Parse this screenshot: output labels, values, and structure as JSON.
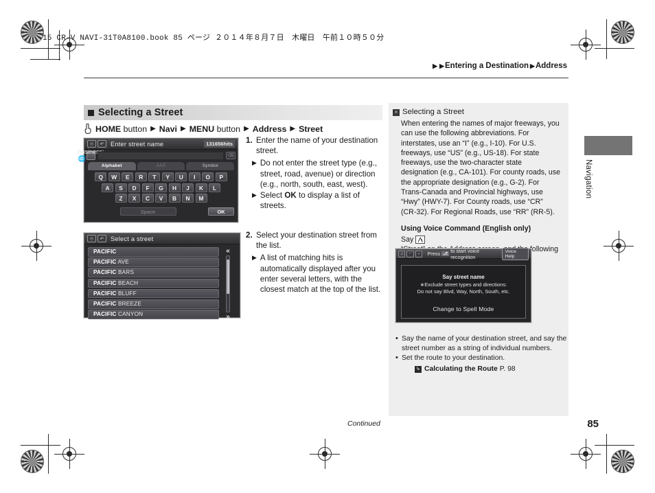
{
  "print": {
    "book_line": "15 CR-V NAVI-31T0A8100.book   85 ページ   ２０１４年８月７日　木曜日　午前１０時５０分"
  },
  "breadcrumb": {
    "tri1": "▶",
    "tri2": "▶",
    "item1": "Entering a Destination",
    "tri3": "▶",
    "item2": "Address"
  },
  "section": {
    "title": "Selecting a Street",
    "path": {
      "home": "HOME",
      "button1": "button",
      "tri1": "▶",
      "navi": "Navi",
      "tri2": "▶",
      "menu": "MENU",
      "button2": "button",
      "tri3": "▶",
      "address": "Address",
      "tri4": "▶",
      "street": "Street"
    }
  },
  "keyboard_screen": {
    "title": "Enter street name",
    "hits": "131656hits",
    "globe_icon": "globe-icon",
    "backspace_icon": "backspace-icon",
    "tabs": [
      {
        "label": "Alphabet",
        "state": "active"
      },
      {
        "label": "ÀÁÂ",
        "state": "dim"
      },
      {
        "label": "Symbol",
        "state": "normal"
      }
    ],
    "rows": [
      [
        "Q",
        "W",
        "E",
        "R",
        "T",
        "Y",
        "U",
        "I",
        "O",
        "P"
      ],
      [
        "A",
        "S",
        "D",
        "F",
        "G",
        "H",
        "J",
        "K",
        "L"
      ],
      [
        "Z",
        "X",
        "C",
        "V",
        "B",
        "N",
        "M"
      ]
    ],
    "space_label": "Space",
    "ok_label": "OK"
  },
  "list_screen": {
    "title": "Select a street",
    "items": [
      {
        "bold": "PACIFIC",
        "rest": ""
      },
      {
        "bold": "PACIFIC",
        "rest": " AVE"
      },
      {
        "bold": "PACIFIC",
        "rest": " BARS"
      },
      {
        "bold": "PACIFIC",
        "rest": " BEACH"
      },
      {
        "bold": "PACIFIC",
        "rest": " BLUFF"
      },
      {
        "bold": "PACIFIC",
        "rest": " BREEZE"
      },
      {
        "bold": "PACIFIC",
        "rest": " CANYON"
      }
    ],
    "scroll_up": "«",
    "scroll_down": "»"
  },
  "steps": {
    "one": {
      "num": "1.",
      "text": "Enter the name of your destination street.",
      "sub1_a": "Do not enter the street type (e.g., street, road, avenue) or direction (e.g., north, south, east, west).",
      "sub2_pre": "Select ",
      "sub2_bold": "OK",
      "sub2_post": " to display a list of streets.",
      "tri": "▶"
    },
    "two": {
      "num": "2.",
      "text": "Select your destination street from the list.",
      "sub1": "A list of matching hits is automatically displayed after you enter several letters, with the closest match at the top of the list.",
      "tri": "▶"
    }
  },
  "sidebar": {
    "glyph": "»",
    "title": "Selecting a Street",
    "paragraph": "When entering the names of major freeways, you can use the following abbreviations. For interstates, use an “I” (e.g., I-10). For U.S. freeways, use “US” (e.g., US-18). For state freeways, use the two-character state designation (e.g., CA-101). For county roads, use the appropriate designation (e.g., G-2). For Trans-Canada and Provincial highways, use “Hwy” (HWY-7). For County roads, use “CR” (CR-32). For Regional Roads, use “RR” (RR-5).",
    "subheading": "Using Voice Command (English only)",
    "say_pre": "Say",
    "say_icon": "voice-talk-icon",
    "say_post": "“Street” on the Address screen, and the following screen is displayed:",
    "bullets": [
      "Say the name of your destination street, and say the street number as a string of individual numbers.",
      "Set the route to your destination."
    ],
    "xref": {
      "icon": "↳",
      "label": "Calculating the Route",
      "page": "P. 98"
    }
  },
  "voice_screen": {
    "bar_text_pre": "Press",
    "bar_key": "⎇",
    "bar_text_post": "to start voice recognition",
    "voice_help": "Voice Help",
    "line1": "Say street name",
    "line2": "∗Exclude street types and directions:",
    "line3": "Do not say Blvd, Way, North, South, etc.",
    "button": "Change to Spell Mode"
  },
  "side_tab": {
    "label": "Navigation"
  },
  "footer": {
    "continued": "Continued",
    "page_number": "85"
  }
}
